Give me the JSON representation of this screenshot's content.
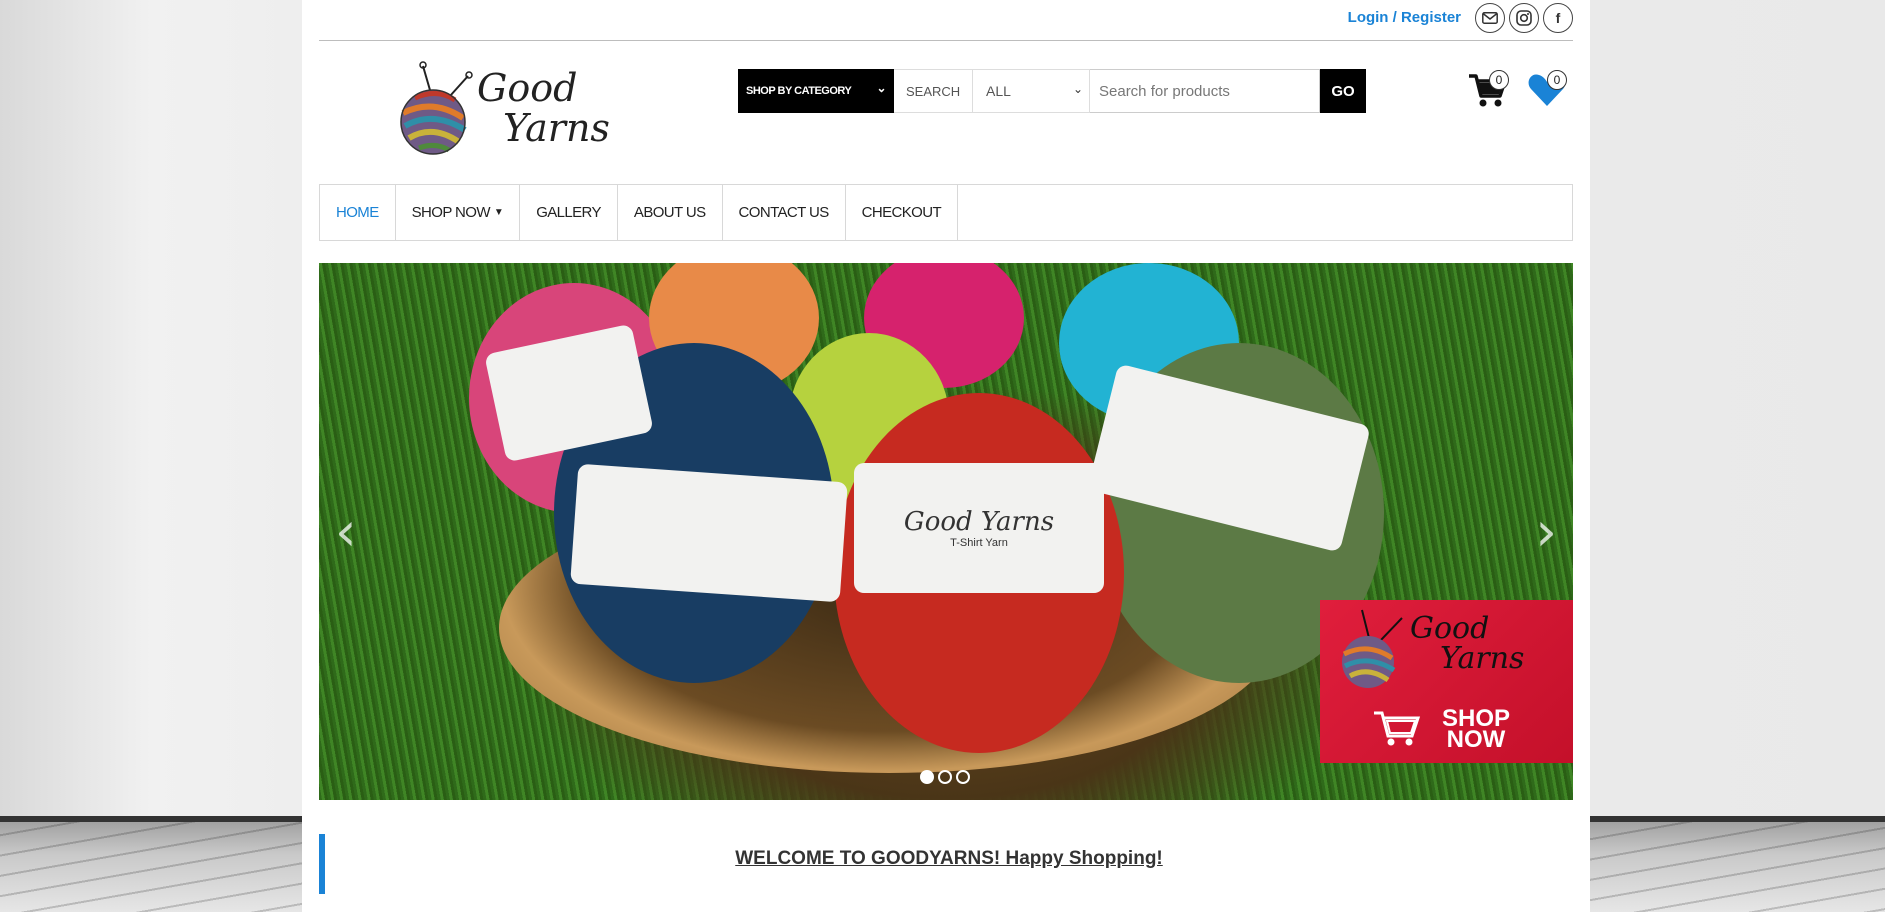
{
  "topbar": {
    "login_label": "Login / Register",
    "socials": [
      {
        "icon": "mail-icon"
      },
      {
        "icon": "instagram-icon"
      },
      {
        "icon": "facebook-icon",
        "glyph": "f"
      }
    ]
  },
  "logo": {
    "line1": "Good",
    "line2": "Yarns"
  },
  "search": {
    "category_label": "SHOP BY CATEGORY",
    "search_label": "SEARCH",
    "scope_value": "ALL",
    "placeholder": "Search for products",
    "go_label": "GO"
  },
  "cart": {
    "count": "0"
  },
  "wishlist": {
    "count": "0"
  },
  "nav": {
    "items": [
      {
        "label": "HOME",
        "active": true
      },
      {
        "label": "SHOP NOW",
        "dropdown": true
      },
      {
        "label": "GALLERY"
      },
      {
        "label": "ABOUT US"
      },
      {
        "label": "CONTACT US"
      },
      {
        "label": "CHECKOUT"
      }
    ]
  },
  "hero": {
    "band_text": "Good Yarns",
    "band_subtext": "T-Shirt Yarn",
    "promo": {
      "logo_line1": "Good",
      "logo_line2": "Yarns",
      "shop_line1": "SHOP",
      "shop_line2": "NOW"
    },
    "slides_total": 3,
    "active_slide": 1
  },
  "welcome": {
    "text": "WELCOME TO GOODYARNS! Happy Shopping!"
  },
  "colors": {
    "accent": "#1a83d6",
    "promo_red": "#e01e3c",
    "black": "#000000"
  }
}
